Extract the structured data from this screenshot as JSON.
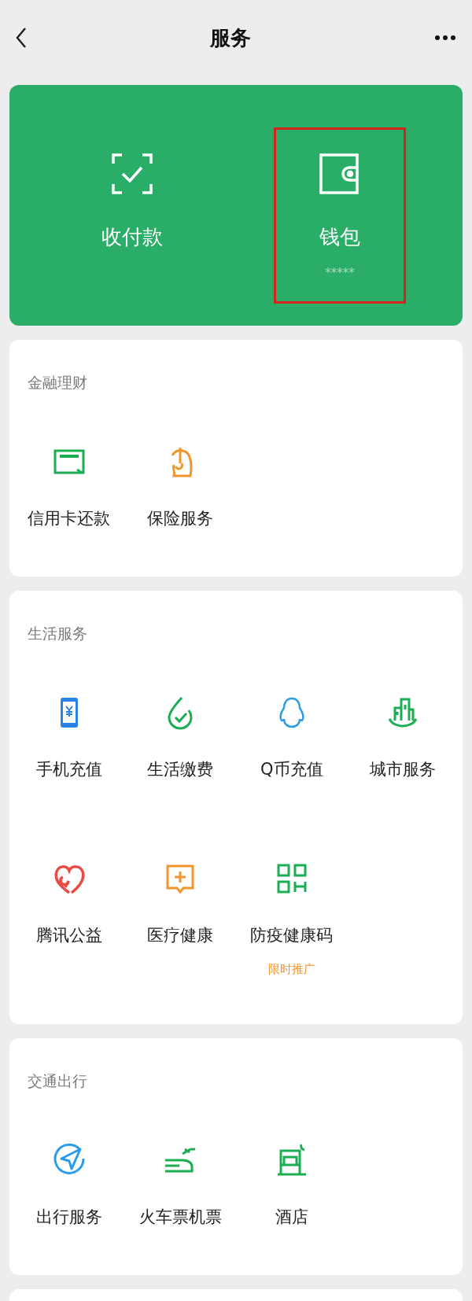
{
  "header": {
    "title": "服务"
  },
  "top_actions": [
    {
      "kind": "scan",
      "label": "收付款",
      "highlighted": false
    },
    {
      "kind": "wallet",
      "label": "钱包",
      "subtitle": "*****",
      "highlighted": true
    }
  ],
  "sections": [
    {
      "title": "金融理财",
      "items": [
        {
          "kind": "card",
          "label": "信用卡还款"
        },
        {
          "kind": "insurance",
          "label": "保险服务"
        }
      ]
    },
    {
      "title": "生活服务",
      "items": [
        {
          "kind": "phone",
          "label": "手机充值"
        },
        {
          "kind": "bill",
          "label": "生活缴费"
        },
        {
          "kind": "penguin",
          "label": "Q币充值"
        },
        {
          "kind": "city",
          "label": "城市服务"
        },
        {
          "kind": "heart",
          "label": "腾讯公益"
        },
        {
          "kind": "medical",
          "label": "医疗健康"
        },
        {
          "kind": "qr",
          "label": "防疫健康码",
          "note": "限时推广"
        }
      ]
    },
    {
      "title": "交通出行",
      "items": [
        {
          "kind": "navigation",
          "label": "出行服务"
        },
        {
          "kind": "train",
          "label": "火车票机票"
        },
        {
          "kind": "hotel",
          "label": "酒店"
        }
      ]
    }
  ]
}
